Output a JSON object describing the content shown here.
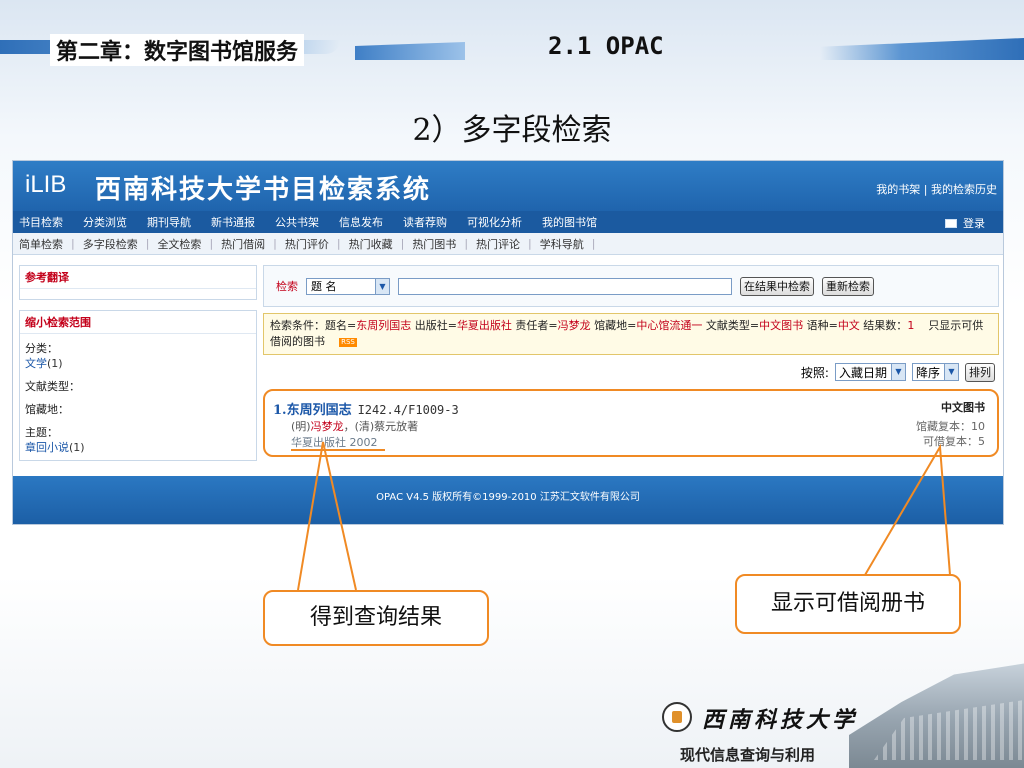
{
  "slide": {
    "chapter": "第二章：数字图书馆服务",
    "section": "2.1  OPAC",
    "subtitle": "2）多字段检索"
  },
  "app": {
    "logo": "iLIB",
    "title": "西南科技大学书目检索系统",
    "top_links": "我的书架 | 我的检索历史",
    "nav": [
      "书目检索",
      "分类浏览",
      "期刊导航",
      "新书通报",
      "公共书架",
      "信息发布",
      "读者荐购",
      "可视化分析",
      "我的图书馆"
    ],
    "login": "登录",
    "subnav": [
      "简单检索",
      "多字段检索",
      "全文检索",
      "热门借阅",
      "热门评价",
      "热门收藏",
      "热门图书",
      "热门评论",
      "学科导航"
    ],
    "ref_panel": {
      "title": "参考翻译"
    },
    "narrow_panel": {
      "title": "缩小检索范围",
      "category_label": "分类：",
      "category_value": "文学",
      "category_count": "(1)",
      "doctype_label": "文献类型：",
      "location_label": "馆藏地：",
      "subject_label": "主题：",
      "subject_value": "章回小说",
      "subject_count": "(1)"
    },
    "search": {
      "label": "检索",
      "field": "题 名",
      "query": "",
      "btn_within": "在结果中检索",
      "btn_new": "重新检索"
    },
    "criteria": {
      "prefix": "检索条件：题名=",
      "title_value": "东周列国志",
      "pub_label": " 出版社=",
      "pub_value": "华夏出版社",
      "resp_label": " 责任者=",
      "resp_value": "冯梦龙",
      "loc_label": " 馆藏地=",
      "loc_value": "中心馆流通一",
      "type_label": " 文献类型=",
      "type_value": "中文图书",
      "lang_label": " 语种=",
      "lang_value": "中文",
      "count_label": " 结果数：",
      "count_value": "1",
      "only_available": "只显示可供借阅的图书",
      "rss": "RSS"
    },
    "sort": {
      "label": "按照:",
      "by": "入藏日期",
      "order": "降序",
      "button": "排列"
    },
    "result": {
      "title": "1.东周列国志",
      "call_number": "I242.4/F1009-3",
      "author_prefix": "(明)",
      "author_highlight": "冯梦龙",
      "author_rest": "，(清)蔡元放著",
      "publisher": "华夏出版社 2002",
      "doc_type": "中文图书",
      "total_copies": "馆藏复本：10",
      "available_copies": "可借复本：5"
    },
    "footer": "OPAC V4.5   版权所有©1999-2010 江苏汇文软件有限公司"
  },
  "callouts": {
    "left": "得到查询结果",
    "right": "显示可借阅册书"
  },
  "branding": {
    "university": "西南科技大学",
    "course": "现代信息查询与利用"
  },
  "colors": {
    "accent_orange": "#f08a24",
    "app_blue": "#1f64ad",
    "highlight_red": "#c3001a"
  }
}
